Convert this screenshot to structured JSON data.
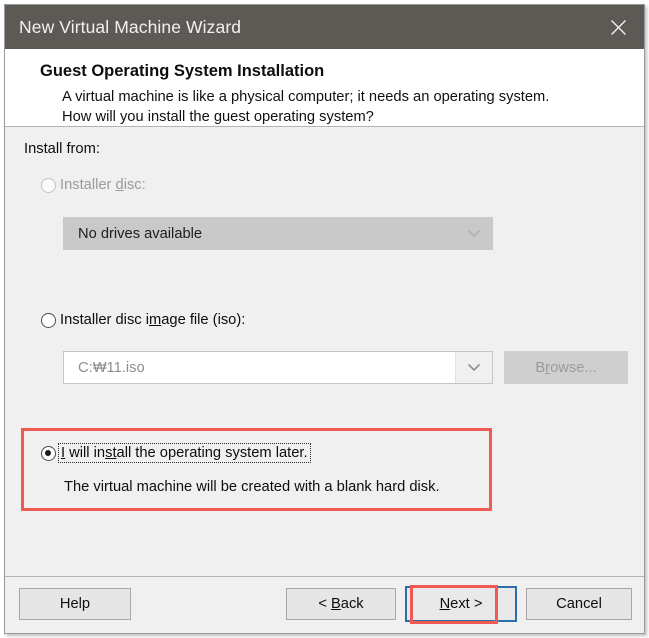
{
  "window": {
    "title": "New Virtual Machine Wizard",
    "close_icon": "close-icon"
  },
  "header": {
    "title": "Guest Operating System Installation",
    "description": "A virtual machine is like a physical computer; it needs an operating system. How will you install the guest operating system?"
  },
  "body": {
    "install_from_label": "Install from:",
    "options": {
      "installer_disc": {
        "label_before": "Installer ",
        "label_accel": "d",
        "label_after": "isc:",
        "selected": false,
        "enabled": false,
        "drive_combo_value": "No drives available"
      },
      "iso_file": {
        "label_before": "Installer disc i",
        "label_accel": "m",
        "label_after": "age file (iso):",
        "selected": false,
        "enabled": true,
        "path_value": "C:₩11.iso",
        "browse_before": "B",
        "browse_accel": "r",
        "browse_after": "owse...",
        "browse_enabled": false
      },
      "install_later": {
        "label_accel1": "I",
        "label_mid": " will in",
        "label_accel2": "st",
        "label_after": "all the operating system later.",
        "selected": true,
        "enabled": true,
        "note": "The virtual machine will be created with a blank hard disk."
      }
    }
  },
  "footer": {
    "help_label": "Help",
    "back_before": "< ",
    "back_accel": "B",
    "back_after": "ack",
    "next_before": "",
    "next_accel": "N",
    "next_after": "ext >",
    "cancel_label": "Cancel"
  },
  "colors": {
    "titlebar": "#5d5a55",
    "annotation": "#f05a52",
    "focus_border": "#2a6fa8"
  }
}
